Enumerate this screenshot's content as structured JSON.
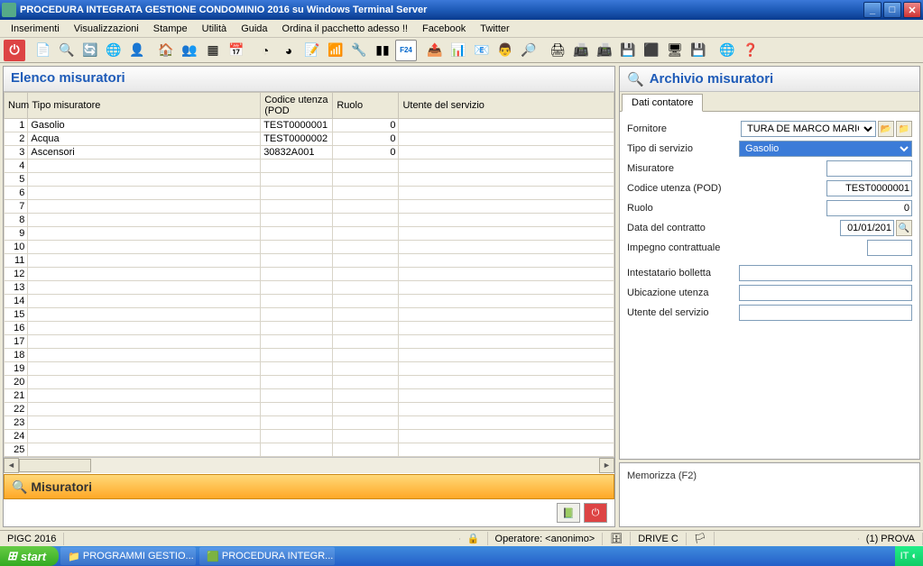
{
  "window": {
    "title": "PROCEDURA INTEGRATA GESTIONE CONDOMINIO 2016 su Windows Terminal Server"
  },
  "menu": [
    "Inserimenti",
    "Visualizzazioni",
    "Stampe",
    "Utilità",
    "Guida",
    "Ordina il pacchetto adesso !!",
    "Facebook",
    "Twitter"
  ],
  "left": {
    "title": "Elenco misuratori",
    "cols": {
      "num": "Num",
      "tipo": "Tipo misuratore",
      "cod": "Codice utenza (POD",
      "ruolo": "Ruolo",
      "utente": "Utente del servizio"
    },
    "rows": [
      {
        "n": 1,
        "tipo": "Gasolio",
        "cod": "TEST0000001",
        "ruolo": "0",
        "utente": ""
      },
      {
        "n": 2,
        "tipo": "Acqua",
        "cod": "TEST0000002",
        "ruolo": "0",
        "utente": ""
      },
      {
        "n": 3,
        "tipo": "Ascensori",
        "cod": "30832A001",
        "ruolo": "0",
        "utente": ""
      }
    ],
    "totalRows": 25,
    "orangeBar": "Misuratori"
  },
  "right": {
    "title": "Archivio misuratori",
    "tab": "Dati contatore",
    "fields": {
      "fornitore_label": "Fornitore",
      "fornitore_value": "TURA DE MARCO MARIO",
      "tipo_label": "Tipo di servizio",
      "tipo_value": "Gasolio",
      "mis_label": "Misuratore",
      "mis_value": "",
      "pod_label": "Codice utenza (POD)",
      "pod_value": "TEST0000001",
      "ruolo_label": "Ruolo",
      "ruolo_value": "0",
      "data_label": "Data del contratto",
      "data_value": "01/01/201",
      "imp_label": "Impegno contrattuale",
      "imp_value": "",
      "intest_label": "Intestatario bolletta",
      "intest_value": "",
      "ubic_label": "Ubicazione utenza",
      "ubic_value": "",
      "utente_label": "Utente del servizio",
      "utente_value": ""
    },
    "memo": "Memorizza (F2)"
  },
  "status": {
    "app": "PIGC 2016",
    "oper": "Operatore: <anonimo>",
    "drive": "DRIVE C",
    "prova": "(1) PROVA"
  },
  "taskbar": {
    "start": "start",
    "items": [
      "PROGRAMMI GESTIO...",
      "PROCEDURA INTEGR..."
    ],
    "lang": "IT"
  }
}
